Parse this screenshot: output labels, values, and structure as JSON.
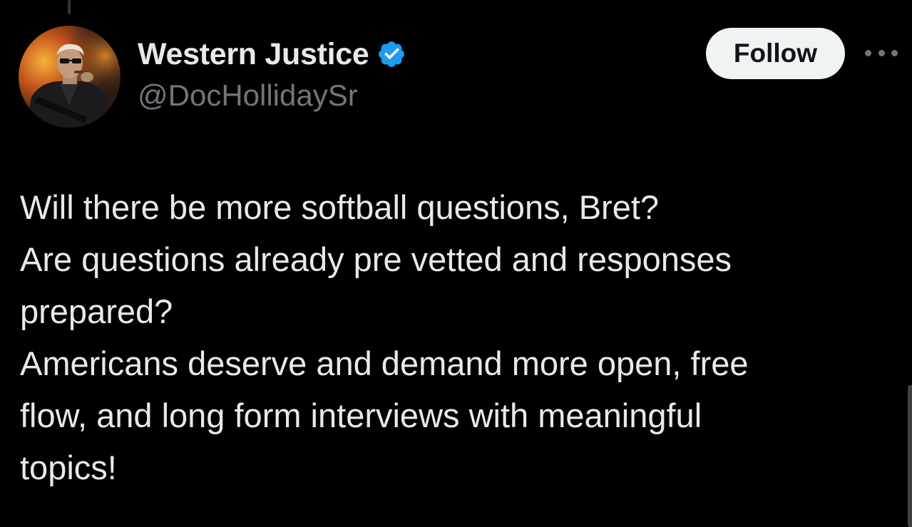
{
  "author": {
    "display_name": "Western Justice",
    "handle": "@DocHollidaySr",
    "verified": true,
    "avatar_icon": "profile-avatar"
  },
  "actions": {
    "follow_label": "Follow",
    "more_icon": "ellipsis-icon"
  },
  "tweet": {
    "lines": [
      "Will there be more softball questions, Bret?",
      "Are questions already pre vetted and responses",
      "prepared?",
      "Americans deserve and demand more open, free",
      "flow, and long form interviews with meaningful",
      "topics!"
    ]
  },
  "colors": {
    "background": "#000000",
    "primary_text": "#e7e9ea",
    "secondary_text": "#71767b",
    "verified_badge": "#1d9bf0",
    "follow_button_bg": "#eff3f4",
    "follow_button_text": "#0f1419"
  }
}
